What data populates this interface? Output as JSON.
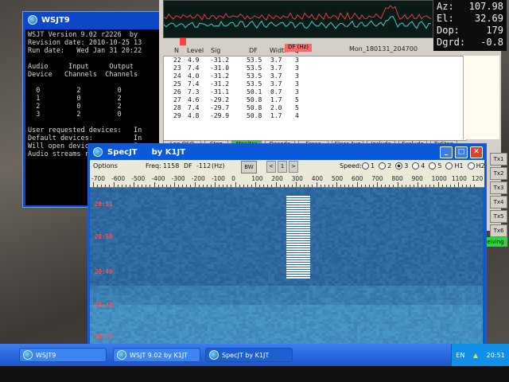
{
  "console": {
    "title": "WSJT9",
    "lines": [
      "WSJT Version 9.02 r2226  by",
      "Revision date: 2010-10-25 13",
      "Run date:   Wed Jan 31 20:22",
      "",
      "Audio     Input     Output",
      "Device   Channels  Channels",
      "",
      "  0         2         0",
      "  1         0         2",
      "  2         0         2",
      "  3         2         0",
      "",
      "User requested devices:   In",
      "Default devices:          In",
      "Will open devices:        In",
      "Audio streams running     "
    ]
  },
  "azel": {
    "rows": [
      {
        "label": "Az:",
        "value": "107.98"
      },
      {
        "label": "El:",
        "value": "32.69"
      },
      {
        "label": "Dop:",
        "value": "179"
      },
      {
        "label": "Dgrd:",
        "value": "-0.8"
      }
    ]
  },
  "decodes": {
    "filename": "Mon_180131_204700",
    "df_badge": "DF (Hz)",
    "headers": {
      "n": "N",
      "level": "Level",
      "sig": "Sig",
      "df": "DF",
      "width": "Width",
      "q": "Q"
    },
    "rows": [
      {
        "n": "22",
        "level": "4.9",
        "sig": "-31.2",
        "df": "53.5",
        "width": "3.7",
        "q": "3"
      },
      {
        "n": "23",
        "level": "7.4",
        "sig": "-31.0",
        "df": "53.5",
        "width": "3.7",
        "q": "3"
      },
      {
        "n": "24",
        "level": "4.0",
        "sig": "-31.2",
        "df": "53.5",
        "width": "3.7",
        "q": "3"
      },
      {
        "n": "25",
        "level": "7.4",
        "sig": "-31.2",
        "df": "53.5",
        "width": "3.7",
        "q": "3"
      },
      {
        "n": "26",
        "level": "7.3",
        "sig": "-31.1",
        "df": "50.1",
        "width": "0.7",
        "q": "3"
      },
      {
        "n": "27",
        "level": "4.6",
        "sig": "-29.2",
        "df": "50.8",
        "width": "1.7",
        "q": "5"
      },
      {
        "n": "28",
        "level": "7.4",
        "sig": "-29.7",
        "df": "50.8",
        "width": "2.0",
        "q": "5"
      },
      {
        "n": "29",
        "level": "4.8",
        "sig": "-29.9",
        "df": "50.8",
        "width": "1.7",
        "q": "4"
      }
    ],
    "buttons": [
      "Log QSO",
      "Stop",
      "Monitor",
      "Decode",
      "Erase",
      "Clear Avg",
      "Include",
      "Exclude",
      "TxStop"
    ]
  },
  "tx_buttons": [
    "Tx1",
    "Tx2",
    "Tx3",
    "Tx4",
    "Tx5",
    "Tx6"
  ],
  "receiving_label": "eiving",
  "specjt": {
    "title": "SpecJT",
    "author": "by K1JT",
    "options_label": "Options",
    "freeze_label": "Freq:",
    "freeze_value": "1158",
    "df_label": "DF",
    "df_value": "-112",
    "df_unit": "(Hz)",
    "bw_label": "BW",
    "nav": [
      "<",
      "1",
      ">"
    ],
    "speed_label": "Speed:",
    "speed_options": [
      "1",
      "2",
      "3",
      "4",
      "5",
      "H1",
      "H2"
    ],
    "speed_selected": "3",
    "scale_labels": [
      "-700",
      "-600",
      "-500",
      "-400",
      "-300",
      "-200",
      "-100",
      "0",
      "100",
      "200",
      "300",
      "400",
      "500",
      "600",
      "700",
      "800",
      "900",
      "1000",
      "1100",
      "120"
    ],
    "timestamps": [
      "20:51",
      "20:50",
      "20:49",
      "20:48",
      "20:47"
    ]
  },
  "taskbar": {
    "tasks": [
      "WSJT9",
      "WSJT 9.02    by K1JT",
      "SpecJT    by K1JT"
    ],
    "lang": "EN",
    "clock": "20:51"
  },
  "colors": {
    "xp_blue": "#0b58d9",
    "timestamp_red": "#ff5050",
    "signal_white": "#f4f4f4"
  }
}
